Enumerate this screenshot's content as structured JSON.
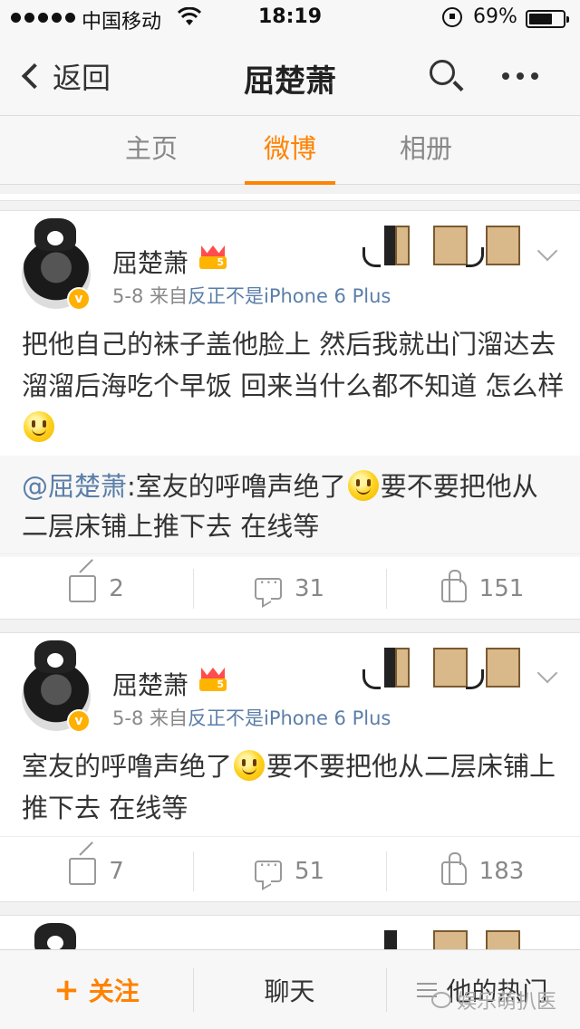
{
  "status_bar": {
    "carrier": "中国移动",
    "time": "18:19",
    "battery": "69%",
    "battery_level": 0.69
  },
  "navbar": {
    "back_label": "返回",
    "title": "屈楚萧"
  },
  "tabs": [
    {
      "label": "主页",
      "active": false
    },
    {
      "label": "微博",
      "active": true
    },
    {
      "label": "相册",
      "active": false
    }
  ],
  "posts": [
    {
      "username": "屈楚萧",
      "member_level": "5",
      "date": "5-8",
      "source_prefix": "来自",
      "source": "反正不是iPhone 6 Plus",
      "text": "把他自己的袜子盖他脸上 然后我就出门溜达去 溜溜后海吃个早饭 回来当什么都不知道 怎么样",
      "repost": {
        "mention": "@屈楚萧",
        "text_before": ":室友的呼噜声绝了",
        "text_after": "要不要把他从二层床铺上推下去 在线等"
      },
      "reposts": "2",
      "comments": "31",
      "likes": "151"
    },
    {
      "username": "屈楚萧",
      "member_level": "5",
      "date": "5-8",
      "source_prefix": "来自",
      "source": "反正不是iPhone 6 Plus",
      "text_before": "室友的呼噜声绝了",
      "text_after": "要不要把他从二层床铺上推下去 在线等",
      "reposts": "7",
      "comments": "51",
      "likes": "183"
    }
  ],
  "bottom_bar": {
    "follow_label": "关注",
    "chat_label": "聊天",
    "hot_label": "他的热门"
  },
  "watermark": "娱乐萌扒医",
  "colors": {
    "accent": "#ff8200",
    "link": "#5b7ea8",
    "background": "#f2f2f2"
  }
}
